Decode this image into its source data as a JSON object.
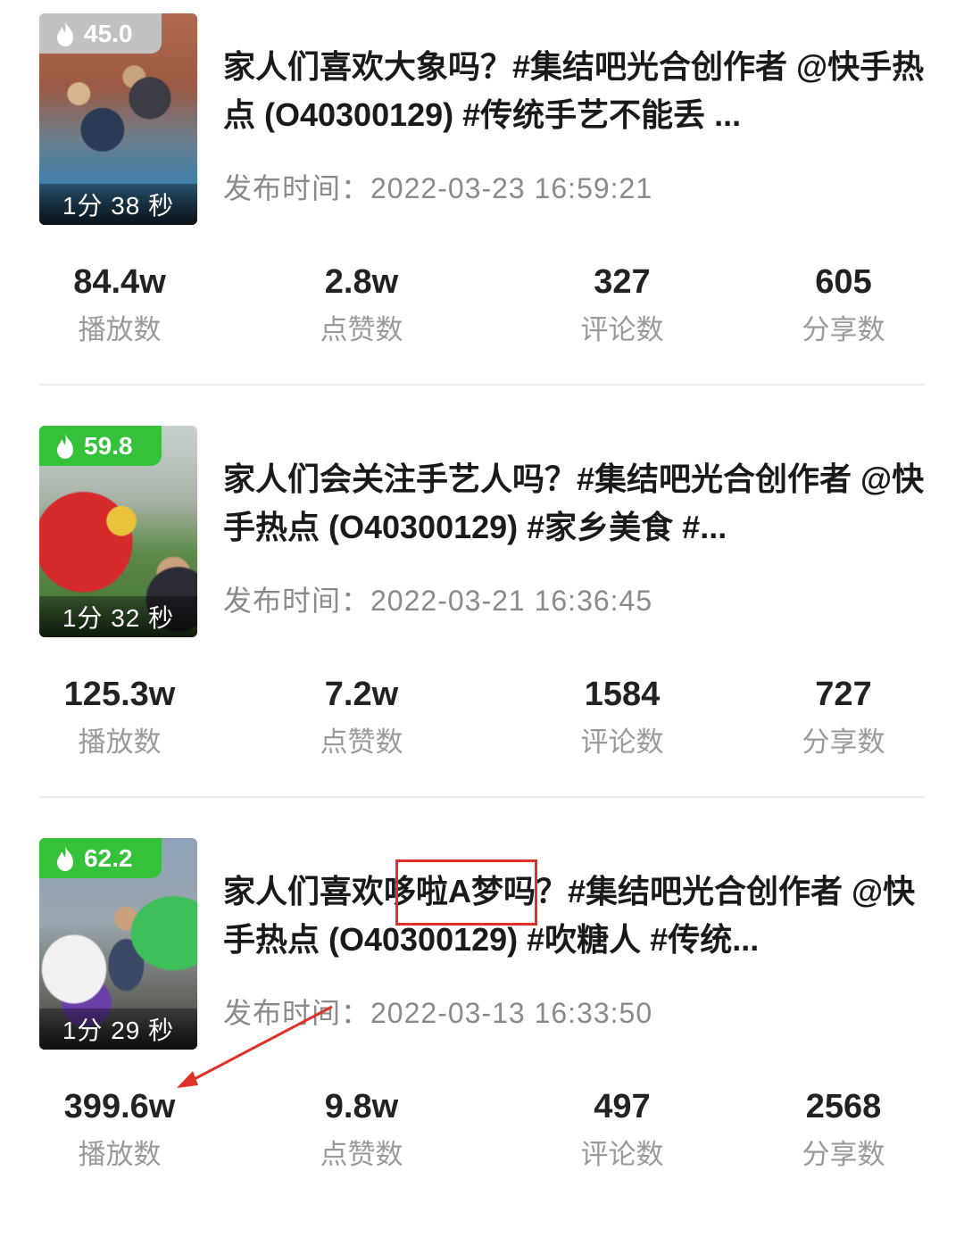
{
  "colors": {
    "heat_gray": "#c2c2c2",
    "heat_green": "#35c23a",
    "annotation_red": "#e0302a"
  },
  "videos": [
    {
      "heat": "45.0",
      "heat_style": "gray",
      "duration": "1分 38 秒",
      "title": "家人们喜欢大象吗？#集结吧光合创作者 @快手热点 (O40300129) #传统手艺不能丢 ...",
      "pubtime": "发布时间：2022-03-23 16:59:21",
      "stats": [
        {
          "value": "84.4w",
          "label": "播放数"
        },
        {
          "value": "2.8w",
          "label": "点赞数"
        },
        {
          "value": "327",
          "label": "评论数"
        },
        {
          "value": "605",
          "label": "分享数"
        }
      ]
    },
    {
      "heat": "59.8",
      "heat_style": "green",
      "duration": "1分 32 秒",
      "title": "家人们会关注手艺人吗？#集结吧光合创作者 @快手热点 (O40300129) #家乡美食 #...",
      "pubtime": "发布时间：2022-03-21 16:36:45",
      "stats": [
        {
          "value": "125.3w",
          "label": "播放数"
        },
        {
          "value": "7.2w",
          "label": "点赞数"
        },
        {
          "value": "1584",
          "label": "评论数"
        },
        {
          "value": "727",
          "label": "分享数"
        }
      ]
    },
    {
      "heat": "62.2",
      "heat_style": "green",
      "duration": "1分 29 秒",
      "title": "家人们喜欢哆啦A梦吗？#集结吧光合创作者 @快手热点 (O40300129) #吹糖人 #传统...",
      "pubtime": "发布时间：2022-03-13 16:33:50",
      "stats": [
        {
          "value": "399.6w",
          "label": "播放数"
        },
        {
          "value": "9.8w",
          "label": "点赞数"
        },
        {
          "value": "497",
          "label": "评论数"
        },
        {
          "value": "2568",
          "label": "分享数"
        }
      ]
    }
  ]
}
